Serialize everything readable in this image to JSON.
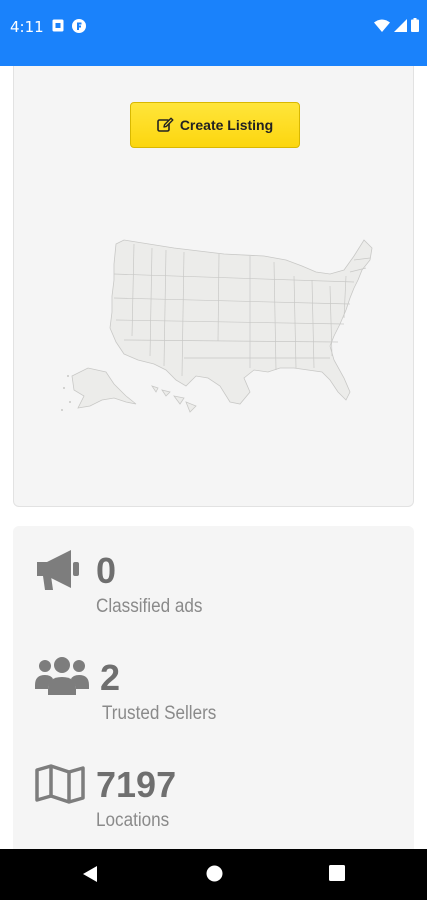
{
  "status_bar": {
    "time": "4:11",
    "icons": [
      "sim-card-icon",
      "app-notification-icon",
      "wifi-icon",
      "signal-icon",
      "battery-icon"
    ],
    "color": "#1a82fb"
  },
  "map_section": {
    "create_button_label": "Create Listing",
    "button_icon": "edit-icon",
    "button_color": "#fde02a",
    "map_icon": "usa-map"
  },
  "stats": [
    {
      "icon": "megaphone-icon",
      "value": "0",
      "label": "Classified ads"
    },
    {
      "icon": "users-icon",
      "value": "2",
      "label": "Trusted Sellers"
    },
    {
      "icon": "map-icon",
      "value": "7197",
      "label": "Locations"
    }
  ],
  "nav_bar": {
    "buttons": [
      "back-icon",
      "home-icon",
      "recents-icon"
    ]
  }
}
